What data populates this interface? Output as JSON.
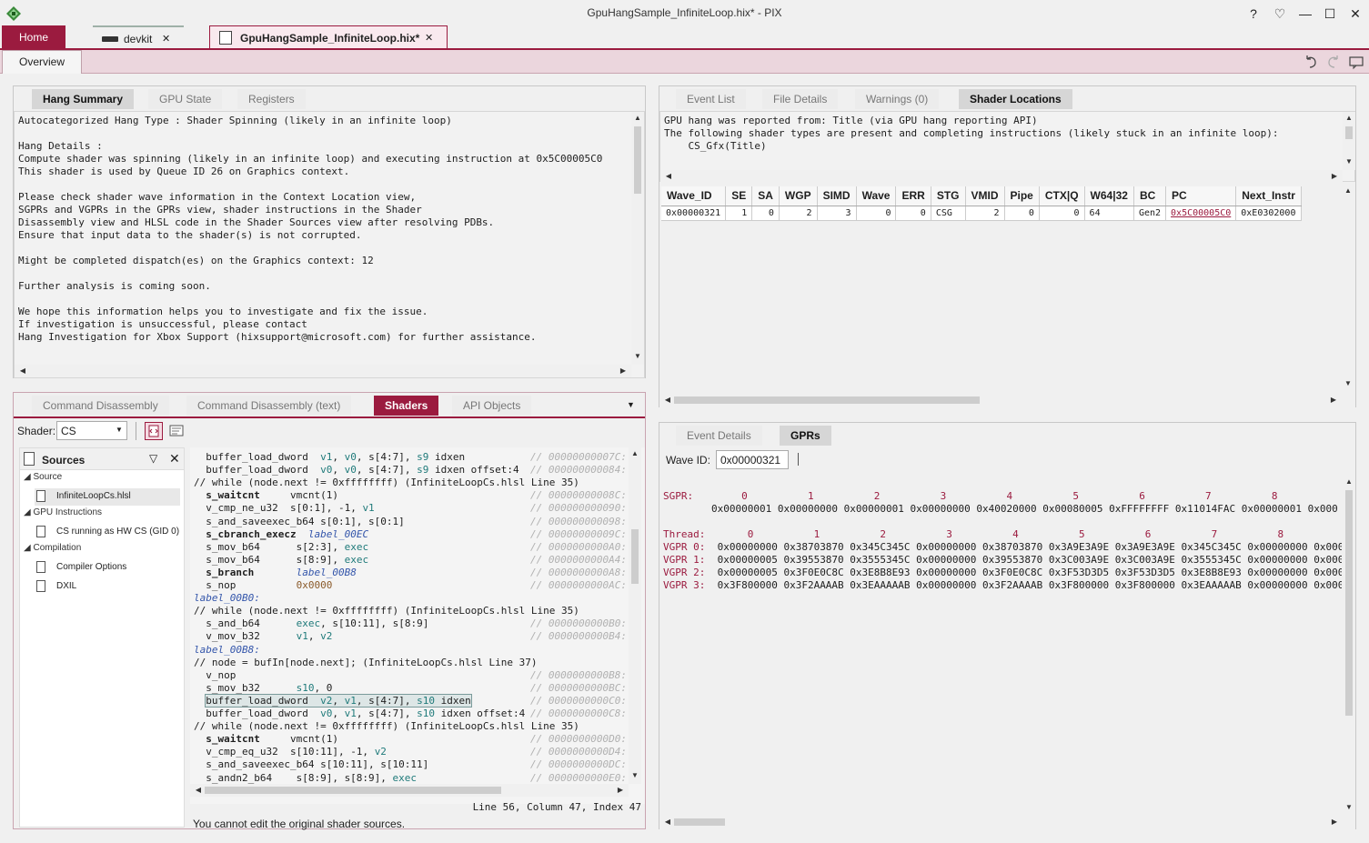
{
  "window": {
    "title": "GpuHangSample_InfiniteLoop.hix* - PIX",
    "buttons": {
      "help": "?",
      "feedback": "♡",
      "minimize": "—",
      "maximize": "☐",
      "close": "✕"
    }
  },
  "tabs": {
    "home": "Home",
    "devkit": "devkit",
    "capture": "GpuHangSample_InfiniteLoop.hix*",
    "close_glyph": "✕"
  },
  "overview": {
    "tab": "Overview"
  },
  "top_left": {
    "tabs": [
      "Hang Summary",
      "GPU State",
      "Registers"
    ],
    "text": "Autocategorized Hang Type : Shader Spinning (likely in an infinite loop)\n\nHang Details :\nCompute shader was spinning (likely in an infinite loop) and executing instruction at 0x5C00005C0\nThis shader is used by Queue ID 26 on Graphics context.\n\nPlease check shader wave information in the Context Location view,\nSGPRs and VGPRs in the GPRs view, shader instructions in the Shader\nDisassembly view and HLSL code in the Shader Sources view after resolving PDBs.\nEnsure that input data to the shader(s) is not corrupted.\n\nMight be completed dispatch(es) on the Graphics context: 12\n\nFurther analysis is coming soon.\n\nWe hope this information helps you to investigate and fix the issue.\nIf investigation is unsuccessful, please contact\nHang Investigation for Xbox Support (hixsupport@microsoft.com) for further assistance."
  },
  "top_right": {
    "tabs": [
      "Event List",
      "File Details",
      "Warnings (0)",
      "Shader Locations"
    ],
    "text": "GPU hang was reported from: Title (via GPU hang reporting API)\nThe following shader types are present and completing instructions (likely stuck in an infinite loop):\n    CS_Gfx(Title)",
    "table": {
      "headers": [
        "Wave_ID",
        "SE",
        "SA",
        "WGP",
        "SIMD",
        "Wave",
        "ERR",
        "STG",
        "VMID",
        "Pipe",
        "CTX|Q",
        "W64|32",
        "BC",
        "PC",
        "Next_Instr"
      ],
      "row": [
        "0x00000321",
        "1",
        "0",
        "2",
        "3",
        "0",
        "0",
        "CSG",
        "2",
        "0",
        "0",
        "64",
        "Gen2",
        "0x5C00005C0",
        "0xE0302000"
      ]
    }
  },
  "bottom_left": {
    "tabs": [
      "Command Disassembly",
      "Command Disassembly (text)",
      "Shaders",
      "API Objects"
    ],
    "shader_label": "Shader:",
    "shader_value": "CS",
    "sources": {
      "title": "Sources",
      "groups": [
        {
          "name": "Source",
          "items": [
            "InfiniteLoopCs.hlsl"
          ]
        },
        {
          "name": "GPU Instructions",
          "items": [
            "CS running as HW CS (GID 0)"
          ]
        },
        {
          "name": "Compilation",
          "items": [
            "Compiler Options",
            "DXIL"
          ]
        }
      ]
    },
    "code": [
      {
        "i": "  ",
        "op": "buffer_load_dword",
        "args": "  v1, v0, s[4:7], s9 idxen",
        "addr": "// 00000000007C:"
      },
      {
        "i": "  ",
        "op": "buffer_load_dword",
        "args": "  v0, v0, s[4:7], s9 idxen offset:4",
        "addr": "// 000000000084:"
      },
      {
        "c": "// while (node.next != 0xffffffff) (InfiniteLoopCs.hlsl Line 35)"
      },
      {
        "i": "  ",
        "op": "s_waitcnt",
        "args": "     vmcnt(1)",
        "addr": "// 00000000008C:",
        "b": true
      },
      {
        "i": "  ",
        "op": "v_cmp_ne_u32",
        "args": "  s[0:1], -1, v1",
        "addr": "// 000000000090:"
      },
      {
        "i": "  ",
        "op": "s_and_saveexec_b64",
        "args": " s[0:1], s[0:1]",
        "addr": "// 000000000098:"
      },
      {
        "i": "  ",
        "op": "s_cbranch_execz",
        "args": "  label_00EC",
        "addr": "// 00000000009C:",
        "b": true
      },
      {
        "i": "  ",
        "op": "s_mov_b64",
        "args": "      s[2:3], exec",
        "addr": "// 0000000000A0:"
      },
      {
        "i": "  ",
        "op": "s_mov_b64",
        "args": "      s[8:9], exec",
        "addr": "// 0000000000A4:"
      },
      {
        "i": "  ",
        "op": "s_branch",
        "args": "       label_00B8",
        "addr": "// 0000000000A8:",
        "b": true
      },
      {
        "i": "  ",
        "op": "s_nop",
        "args": "          0x0000",
        "addr": "// 0000000000AC:"
      },
      {
        "l": "label_00B0:"
      },
      {
        "c": "// while (node.next != 0xffffffff) (InfiniteLoopCs.hlsl Line 35)"
      },
      {
        "i": "  ",
        "op": "s_and_b64",
        "args": "      exec, s[10:11], s[8:9]",
        "addr": "// 0000000000B0:"
      },
      {
        "i": "  ",
        "op": "v_mov_b32",
        "args": "      v1, v2",
        "addr": "// 0000000000B4:"
      },
      {
        "l": "label_00B8:"
      },
      {
        "c": "// node = bufIn[node.next]; (InfiniteLoopCs.hlsl Line 37)"
      },
      {
        "i": "  ",
        "op": "v_nop",
        "args": "",
        "addr": "// 0000000000B8:"
      },
      {
        "i": "  ",
        "op": "s_mov_b32",
        "args": "      s10, 0",
        "addr": "// 0000000000BC:"
      },
      {
        "i": "  ",
        "op": "buffer_load_dword",
        "args": "  v2, v1, s[4:7], s10 idxen",
        "addr": "// 0000000000C0:",
        "sel": true
      },
      {
        "i": "  ",
        "op": "buffer_load_dword",
        "args": "  v0, v1, s[4:7], s10 idxen offset:4",
        "addr": "// 0000000000C8:"
      },
      {
        "c": "// while (node.next != 0xffffffff) (InfiniteLoopCs.hlsl Line 35)"
      },
      {
        "i": "  ",
        "op": "s_waitcnt",
        "args": "     vmcnt(1)",
        "addr": "// 0000000000D0:",
        "b": true
      },
      {
        "i": "  ",
        "op": "v_cmp_eq_u32",
        "args": "  s[10:11], -1, v2",
        "addr": "// 0000000000D4:"
      },
      {
        "i": "  ",
        "op": "s_and_saveexec_b64",
        "args": " s[10:11], s[10:11]",
        "addr": "// 0000000000DC:"
      },
      {
        "i": "  ",
        "op": "s_andn2_b64",
        "args": "    s[8:9], s[8:9], exec",
        "addr": "// 0000000000E0:"
      }
    ],
    "status": "Line 56, Column 47, Index 47",
    "footer": "You cannot edit the original shader sources."
  },
  "bottom_right": {
    "tabs": [
      "Event Details",
      "GPRs"
    ],
    "wave_label": "Wave ID:",
    "wave_value": "0x00000321",
    "gpr_lines": [
      "SGPR:        0          1          2          3          4          5          6          7          8",
      "        0x00000001 0x00000000 0x00000001 0x00000000 0x40020000 0x00080005 0xFFFFFFFF 0x11014FAC 0x00000001 0x000",
      "",
      "Thread:       0          1          2          3          4          5          6          7          8",
      "VGPR 0:  0x00000000 0x38703870 0x345C345C 0x00000000 0x38703870 0x3A9E3A9E 0x3A9E3A9E 0x345C345C 0x00000000 0x000",
      "VGPR 1:  0x00000005 0x39553870 0x3555345C 0x00000000 0x39553870 0x3C003A9E 0x3C003A9E 0x3555345C 0x00000000 0x000",
      "VGPR 2:  0x00000005 0x3F0E0C8C 0x3E8B8E93 0x00000000 0x3F0E0C8C 0x3F53D3D5 0x3F53D3D5 0x3E8B8E93 0x00000000 0x000",
      "VGPR 3:  0x3F800000 0x3F2AAAAB 0x3EAAAAAB 0x00000000 0x3F2AAAAB 0x3F800000 0x3F800000 0x3EAAAAAB 0x00000000 0x000"
    ]
  },
  "colors": {
    "accent": "#9b1b3f",
    "label_blue": "#3355aa",
    "reg_teal": "#1f7a7a"
  },
  "icons": [
    "pix-logo-icon",
    "devkit-icon",
    "capture-file-icon",
    "undo-icon",
    "redo-icon",
    "comment-icon",
    "dropdown-icon",
    "filter-icon",
    "close-icon",
    "file-icon"
  ]
}
